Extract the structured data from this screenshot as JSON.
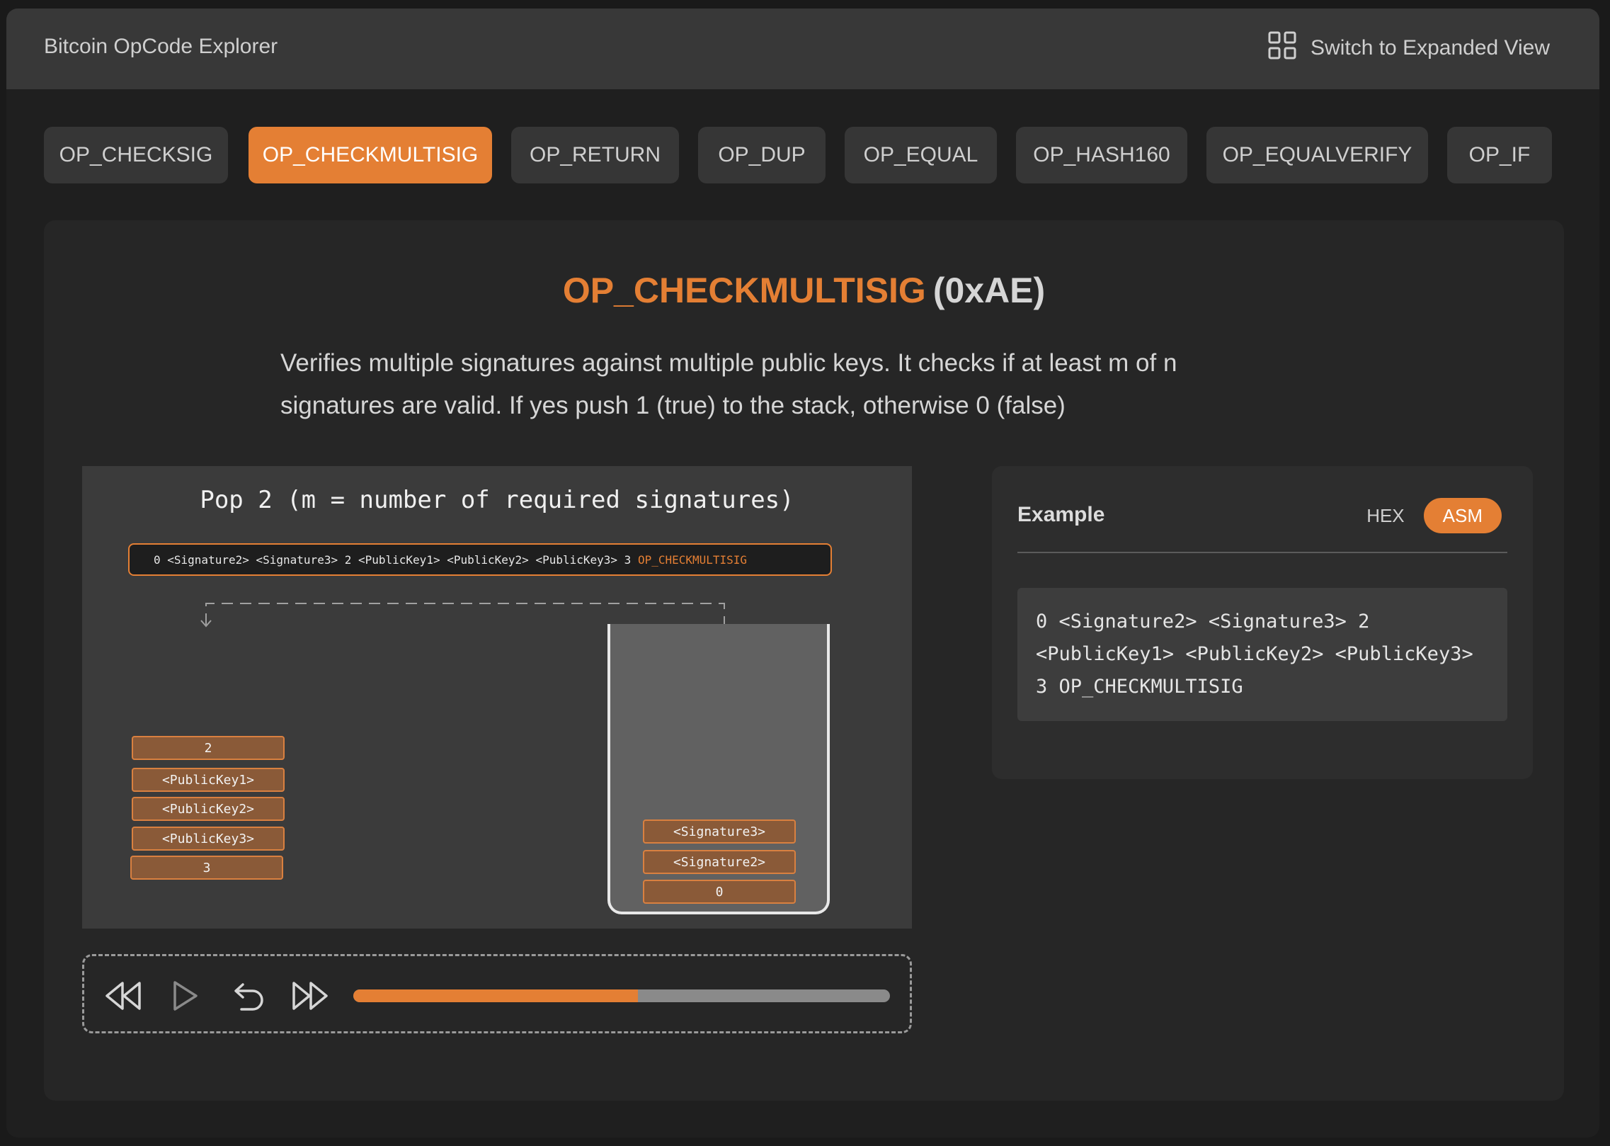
{
  "app": {
    "title": "Bitcoin OpCode Explorer",
    "expand_label": "Switch to Expanded View"
  },
  "tabs": [
    {
      "label": "OP_CHECKSIG",
      "active": false
    },
    {
      "label": "OP_CHECKMULTISIG",
      "active": true
    },
    {
      "label": "OP_RETURN",
      "active": false
    },
    {
      "label": "OP_DUP",
      "active": false
    },
    {
      "label": "OP_EQUAL",
      "active": false
    },
    {
      "label": "OP_HASH160",
      "active": false
    },
    {
      "label": "OP_EQUALVERIFY",
      "active": false
    },
    {
      "label": "OP_IF",
      "active": false
    }
  ],
  "opcode": {
    "name": "OP_CHECKMULTISIG",
    "code": "(0xAE)",
    "description": "Verifies multiple signatures against multiple public keys. It checks if at least m of n signatures are valid. If yes push 1 (true) to the stack, otherwise 0 (false)"
  },
  "viz": {
    "caption": "Pop 2 (m = number of required signatures)",
    "script_prefix": "0 <Signature2> <Signature3> 2 <PublicKey1> <PublicKey2> <PublicKey3> 3 ",
    "script_highlight": "OP_CHECKMULTISIG",
    "popped_items": [
      "2",
      "<PublicKey1>",
      "<PublicKey2>",
      "<PublicKey3>",
      "3"
    ],
    "stack_items": [
      "<Signature3>",
      "<Signature2>",
      "0"
    ]
  },
  "player": {
    "progress_percent": 53
  },
  "example": {
    "title": "Example",
    "toggle_hex": "HEX",
    "toggle_asm": "ASM",
    "selected": "ASM",
    "code": "0 <Signature2> <Signature3> 2\n<PublicKey1> <PublicKey2> <PublicKey3>\n3 OP_CHECKMULTISIG"
  },
  "colors": {
    "accent": "#e47f34",
    "background": "#1f1f1f",
    "panel": "#262626"
  },
  "icons": [
    "grid-icon",
    "rewind-icon",
    "play-icon",
    "undo-icon",
    "fast-forward-icon"
  ]
}
